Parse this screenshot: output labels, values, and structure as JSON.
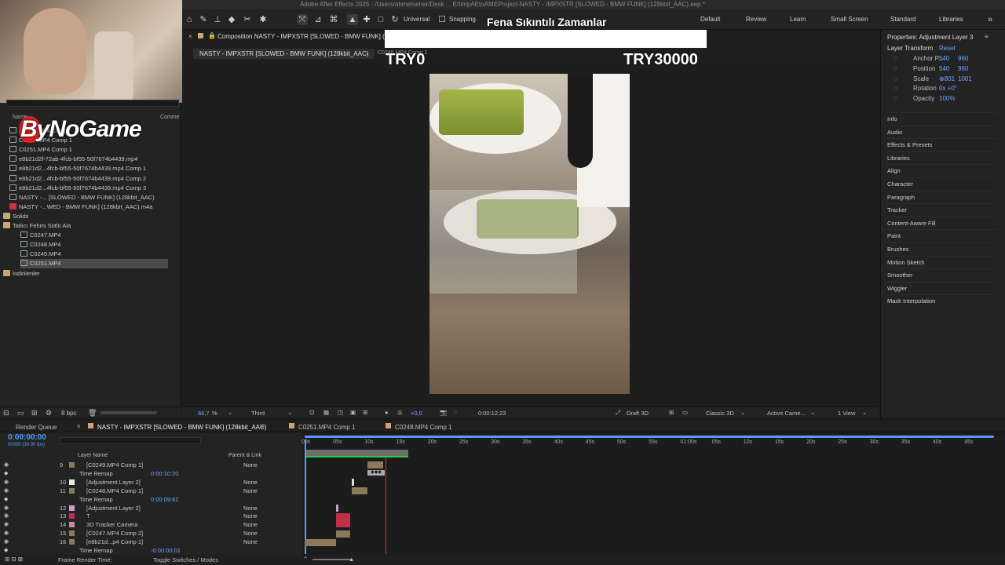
{
  "window_title": "Adobe After Effects 2025 - /Users/ahmetsener/Desk ... E/timpAEtoAMEProject-NASTY - IMPXSTR [SLOWED - BMW FUNK] (128kbit_AAC).aep *",
  "toolbar": {
    "universal_label": "Universal",
    "snapping_label": "Snapping",
    "workspaces": [
      "Default",
      "Review",
      "Learn",
      "Small Screen",
      "Standard",
      "Libraries"
    ]
  },
  "overlay": {
    "title": "Fena Sıkıntılı Zamanlar",
    "left_counter": "TRY0",
    "right_counter": "TRY30000",
    "logo": "ByNoGame"
  },
  "project_panel": {
    "col_name": "Name",
    "col_comment": "Comme",
    "items": [
      {
        "name": "C0248.MP4 Comp",
        "type": "comp",
        "indent": 0
      },
      {
        "name": "C0249.MP4 Comp 1",
        "type": "comp",
        "indent": 0
      },
      {
        "name": "C0251.MP4 Comp 1",
        "type": "comp",
        "indent": 0
      },
      {
        "name": "e8b21d2f-72ab-4fcb-bf55-50f7674b4439.mp4",
        "type": "file",
        "indent": 0
      },
      {
        "name": "e8b21d2...4fcb-bf55-50f7674b4439.mp4 Comp 1",
        "type": "comp",
        "indent": 0
      },
      {
        "name": "e8b21d2...4fcb-bf55-50f7674b4439.mp4 Comp 2",
        "type": "comp",
        "indent": 0
      },
      {
        "name": "e8b21d2...4fcb-bf55-50f7674b4439.mp4 Comp 3",
        "type": "comp",
        "indent": 0
      },
      {
        "name": "NASTY -... [SLOWED - BMW FUNK] (128kbit_AAC)",
        "type": "comp",
        "indent": 0
      },
      {
        "name": "NASTY -...WED - BMW FUNK] (128kbit_AAC).m4a",
        "type": "audio",
        "indent": 0
      },
      {
        "name": "Solids",
        "type": "folder",
        "indent": 0
      },
      {
        "name": "Tatlıcı Fehmi Sütlü Ala",
        "type": "folder",
        "indent": 0
      },
      {
        "name": "C0247.MP4",
        "type": "file",
        "indent": 1
      },
      {
        "name": "C0248.MP4",
        "type": "file",
        "indent": 1
      },
      {
        "name": "C0249.MP4",
        "type": "file",
        "indent": 1
      },
      {
        "name": "C0251.MP4",
        "type": "file",
        "indent": 1,
        "selected": true
      },
      {
        "name": "İndirilenler",
        "type": "folder",
        "indent": 0
      }
    ],
    "bpc": "8 bpc"
  },
  "composition": {
    "panel_title": "Composition NASTY - IMPXSTR [SLOWED - BMW FUNK] (128",
    "tab_label": "NASTY - IMPXSTR [SLOWED - BMW FUNK] (128kbit_AAC)",
    "breadcrumb_next": "C0248.MP4 Comp 1",
    "zoom": "66,7",
    "zoom_unit": "%",
    "resolution": "Third",
    "exposure": "+0,0",
    "timecode": "0:00:12:23",
    "renderer": "Draft 3D",
    "renderer_mode": "Classic 3D",
    "camera": "Active Came...",
    "views": "1 View"
  },
  "properties": {
    "title": "Properties: Adjustment Layer 3",
    "section": "Layer Transform",
    "reset": "Reset",
    "rows": [
      {
        "label": "Anchor P...",
        "v1": "540",
        "v2": "960"
      },
      {
        "label": "Position",
        "v1": "540",
        "v2": "960"
      },
      {
        "label": "Scale",
        "v1": "⊗801",
        "v2": "1001"
      },
      {
        "label": "Rotation",
        "v1": "0x +0°",
        "v2": ""
      },
      {
        "label": "Opacity",
        "v1": "100%",
        "v2": ""
      }
    ],
    "panels": [
      "Info",
      "Audio",
      "Effects & Presets",
      "Libraries",
      "Align",
      "Character",
      "Paragraph",
      "Tracker",
      "Content-Aware Fill",
      "Paint",
      "Brushes",
      "Motion Sketch",
      "Smoother",
      "Wiggler",
      "Mask Interpolation"
    ]
  },
  "timeline": {
    "tabs": [
      "Render Queue",
      "NASTY - IMPXSTR [SLOWED - BMW FUNK] (128kbit_AAC)",
      "C0251.MP4 Comp 1",
      "C0248.MP4 Comp 1"
    ],
    "current_time": "0:00:00:00",
    "fps_label": "00000 (30.00 fps)",
    "col_layer_name": "Layer Name",
    "col_parent": "Parent & Link",
    "ruler": [
      "00s",
      "05s",
      "10s",
      "15s",
      "20s",
      "25s",
      "30s",
      "35s",
      "40s",
      "45s",
      "50s",
      "55s",
      "01:00s",
      "05s",
      "10s",
      "15s",
      "20s",
      "25s",
      "30s",
      "35s",
      "40s",
      "45s"
    ],
    "layers": [
      {
        "num": "9",
        "name": "[C0249.MP4 Comp 1]",
        "parent": "None",
        "color": "#8a7a5a",
        "kind": "layer"
      },
      {
        "num": "",
        "name": "Time Remap",
        "value": "0:00:10:20",
        "kind": "sub"
      },
      {
        "num": "10",
        "name": "[Adjustment Layer 2]",
        "parent": "None",
        "color": "#e8e8e8",
        "kind": "layer"
      },
      {
        "num": "11",
        "name": "[C0248.MP4 Comp 1]",
        "parent": "None",
        "color": "#8a7a5a",
        "kind": "layer"
      },
      {
        "num": "",
        "name": "Time Remap",
        "value": "0:00:09:62",
        "kind": "sub"
      },
      {
        "num": "12",
        "name": "[Adjustment Layer 2]",
        "parent": "None",
        "color": "#c8a0c8",
        "kind": "layer"
      },
      {
        "num": "13",
        "name": "T",
        "parent": "None",
        "color": "#c0304a",
        "kind": "layer"
      },
      {
        "num": "14",
        "name": "3D Tracker Camera",
        "parent": "None",
        "color": "#c88aa0",
        "kind": "layer"
      },
      {
        "num": "15",
        "name": "[C0247.MP4 Comp 2]",
        "parent": "None",
        "color": "#8a7a5a",
        "kind": "layer"
      },
      {
        "num": "16",
        "name": "[e8b21d...p4 Comp 1]",
        "parent": "None",
        "color": "#8a7a5a",
        "kind": "layer"
      },
      {
        "num": "",
        "name": "Time Remap",
        "value": "-0:00:00:01",
        "kind": "sub"
      }
    ],
    "frame_render_time": "Frame Render Time:",
    "toggle_label": "Toggle Switches / Modes"
  }
}
